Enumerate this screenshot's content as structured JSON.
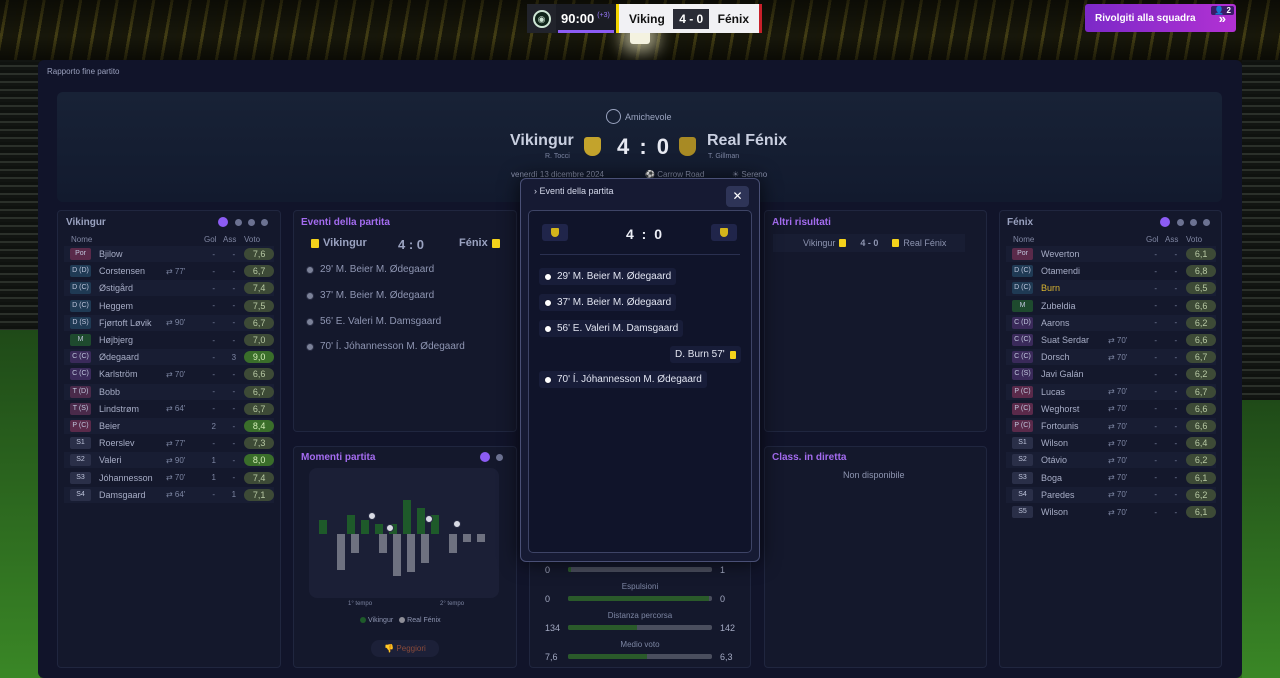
{
  "scoreboard": {
    "time": "90:00",
    "added": "(+3)",
    "home": "Viking",
    "score": "4 - 0",
    "away": "Fénix"
  },
  "help": {
    "label": "Rivolgiti alla squadra",
    "badge": "2"
  },
  "page_title": "Rapporto fine partito",
  "match": {
    "competition": "Amichevole",
    "home": "Vikingur",
    "home_manager": "R. Tocci",
    "score": "4 : 0",
    "away": "Real Fénix",
    "away_manager": "T. Gillman",
    "date": "venerdì 13 dicembre 2024",
    "stadium": "Carrow Road",
    "weather": "Sereno"
  },
  "colors": {
    "accent": "#8c5cf4",
    "yellow": "#f4d21b",
    "panel": "#14182c"
  },
  "home_table": {
    "title": "Vikingur",
    "headers": {
      "name": "Nome",
      "gol": "Gol",
      "ass": "Ass",
      "vote": "Voto"
    },
    "rows": [
      {
        "pos": "Por",
        "name": "Bjilow",
        "sub": "",
        "gol": "-",
        "ass": "-",
        "vote": "7,6"
      },
      {
        "pos": "D (D)",
        "name": "Corstensen",
        "sub": "77'",
        "gol": "-",
        "ass": "-",
        "vote": "6,7"
      },
      {
        "pos": "D (C)",
        "name": "Østigård",
        "sub": "",
        "gol": "-",
        "ass": "-",
        "vote": "7,4"
      },
      {
        "pos": "D (C)",
        "name": "Heggem",
        "sub": "",
        "gol": "-",
        "ass": "-",
        "vote": "7,5"
      },
      {
        "pos": "D (S)",
        "name": "Fjørtoft Løvik",
        "sub": "90'",
        "gol": "-",
        "ass": "-",
        "vote": "6,7"
      },
      {
        "pos": "M",
        "name": "Højbjerg",
        "sub": "",
        "gol": "-",
        "ass": "-",
        "vote": "7,0"
      },
      {
        "pos": "C (C)",
        "name": "Ødegaard",
        "sub": "",
        "gol": "-",
        "ass": "3",
        "vote": "9,0"
      },
      {
        "pos": "C (C)",
        "name": "Karlström",
        "sub": "70'",
        "gol": "-",
        "ass": "-",
        "vote": "6,6"
      },
      {
        "pos": "T (D)",
        "name": "Bobb",
        "sub": "",
        "gol": "-",
        "ass": "-",
        "vote": "6,7"
      },
      {
        "pos": "T (S)",
        "name": "Lindstrøm",
        "sub": "64'",
        "gol": "-",
        "ass": "-",
        "vote": "6,7"
      },
      {
        "pos": "P (C)",
        "name": "Beier",
        "sub": "",
        "gol": "2",
        "ass": "-",
        "vote": "8,4"
      },
      {
        "pos": "S1",
        "name": "Roerslev",
        "sub": "77'",
        "gol": "-",
        "ass": "-",
        "vote": "7,3"
      },
      {
        "pos": "S2",
        "name": "Valeri",
        "sub": "90'",
        "gol": "1",
        "ass": "-",
        "vote": "8,0"
      },
      {
        "pos": "S3",
        "name": "Jóhannesson",
        "sub": "70'",
        "gol": "1",
        "ass": "-",
        "vote": "7,4"
      },
      {
        "pos": "S4",
        "name": "Damsgaard",
        "sub": "64'",
        "gol": "-",
        "ass": "1",
        "vote": "7,1"
      }
    ]
  },
  "away_table": {
    "title": "Fénix",
    "headers": {
      "name": "Nome",
      "gol": "Gol",
      "ass": "Ass",
      "vote": "Voto"
    },
    "rows": [
      {
        "pos": "Por",
        "name": "Weverton",
        "sub": "",
        "gol": "-",
        "ass": "-",
        "vote": "6,1"
      },
      {
        "pos": "D (C)",
        "name": "Otamendi",
        "sub": "",
        "gol": "-",
        "ass": "-",
        "vote": "6,8"
      },
      {
        "pos": "D (C)",
        "name": "Burn",
        "sub": "",
        "gol": "-",
        "ass": "-",
        "vote": "6,5"
      },
      {
        "pos": "M",
        "name": "Zubeldia",
        "sub": "",
        "gol": "-",
        "ass": "-",
        "vote": "6,6"
      },
      {
        "pos": "C (D)",
        "name": "Aarons",
        "sub": "",
        "gol": "-",
        "ass": "-",
        "vote": "6,2"
      },
      {
        "pos": "C (C)",
        "name": "Suat Serdar",
        "sub": "70'",
        "gol": "-",
        "ass": "-",
        "vote": "6,6"
      },
      {
        "pos": "C (C)",
        "name": "Dorsch",
        "sub": "70'",
        "gol": "-",
        "ass": "-",
        "vote": "6,7"
      },
      {
        "pos": "C (S)",
        "name": "Javi Galán",
        "sub": "",
        "gol": "-",
        "ass": "-",
        "vote": "6,2"
      },
      {
        "pos": "P (C)",
        "name": "Lucas",
        "sub": "70'",
        "gol": "-",
        "ass": "-",
        "vote": "6,7"
      },
      {
        "pos": "P (C)",
        "name": "Weghorst",
        "sub": "70'",
        "gol": "-",
        "ass": "-",
        "vote": "6,6"
      },
      {
        "pos": "P (C)",
        "name": "Fortounis",
        "sub": "70'",
        "gol": "-",
        "ass": "-",
        "vote": "6,6"
      },
      {
        "pos": "S1",
        "name": "Wilson",
        "sub": "70'",
        "gol": "-",
        "ass": "-",
        "vote": "6,4"
      },
      {
        "pos": "S2",
        "name": "Otávio",
        "sub": "70'",
        "gol": "-",
        "ass": "-",
        "vote": "6,2"
      },
      {
        "pos": "S3",
        "name": "Boga",
        "sub": "70'",
        "gol": "-",
        "ass": "-",
        "vote": "6,1"
      },
      {
        "pos": "S4",
        "name": "Paredes",
        "sub": "70'",
        "gol": "-",
        "ass": "-",
        "vote": "6,2"
      },
      {
        "pos": "S5",
        "name": "Wilson",
        "sub": "70'",
        "gol": "-",
        "ass": "-",
        "vote": "6,1"
      }
    ]
  },
  "events_card": {
    "title": "Eventi della partita",
    "home": "Vikingur",
    "score": "4 : 0",
    "away": "Fénix",
    "events": [
      "29' M. Beier M. Ødegaard",
      "37' M. Beier M. Ødegaard",
      "56' E. Valeri M. Damsgaard",
      "70' Í. Jóhannesson M. Ødegaard"
    ]
  },
  "moments": {
    "title": "Momenti partita",
    "first_half": "1° tempo",
    "second_half": "2° tempo",
    "legend_home": "Vikingur",
    "legend_away": "Real Fénix",
    "worse": "Peggiori"
  },
  "chart_data": {
    "type": "bar",
    "title": "Momenti partita",
    "series": [
      {
        "name": "Vikingur",
        "values": [
          1.2,
          0,
          1.6,
          1.2,
          0.8,
          0.8,
          2.8,
          2.2,
          1.6,
          0,
          0,
          0
        ]
      },
      {
        "name": "Real Fénix",
        "values": [
          0,
          3,
          1.6,
          0,
          1.6,
          3.5,
          3.2,
          2.4,
          0,
          1.6,
          0.7,
          0.7
        ]
      }
    ],
    "xlabel": "",
    "ylabel": ""
  },
  "others": {
    "title": "Altri risultati",
    "home": "Vikingur",
    "score": "4 - 0",
    "away": "Real Fénix"
  },
  "live": {
    "title": "Class. in diretta",
    "na": "Non disponibile"
  },
  "stats": [
    {
      "label": "",
      "home": "0",
      "away": "1",
      "home_frac": 0.02
    },
    {
      "label": "Espulsioni",
      "home": "0",
      "away": "0",
      "home_frac": 0.98
    },
    {
      "label": "Distanza percorsa",
      "home": "134",
      "away": "142",
      "home_frac": 0.48
    },
    {
      "label": "Medio voto",
      "home": "7,6",
      "away": "6,3",
      "home_frac": 0.55
    }
  ],
  "popup": {
    "title": "Eventi della partita",
    "score": "4 : 0",
    "events": [
      "29' M. Beier M. Ødegaard",
      "37' M. Beier M. Ødegaard",
      "56' E. Valeri M. Damsgaard",
      "70' Í. Jóhannesson M. Ødegaard"
    ],
    "card_event": "D. Burn 57'"
  }
}
